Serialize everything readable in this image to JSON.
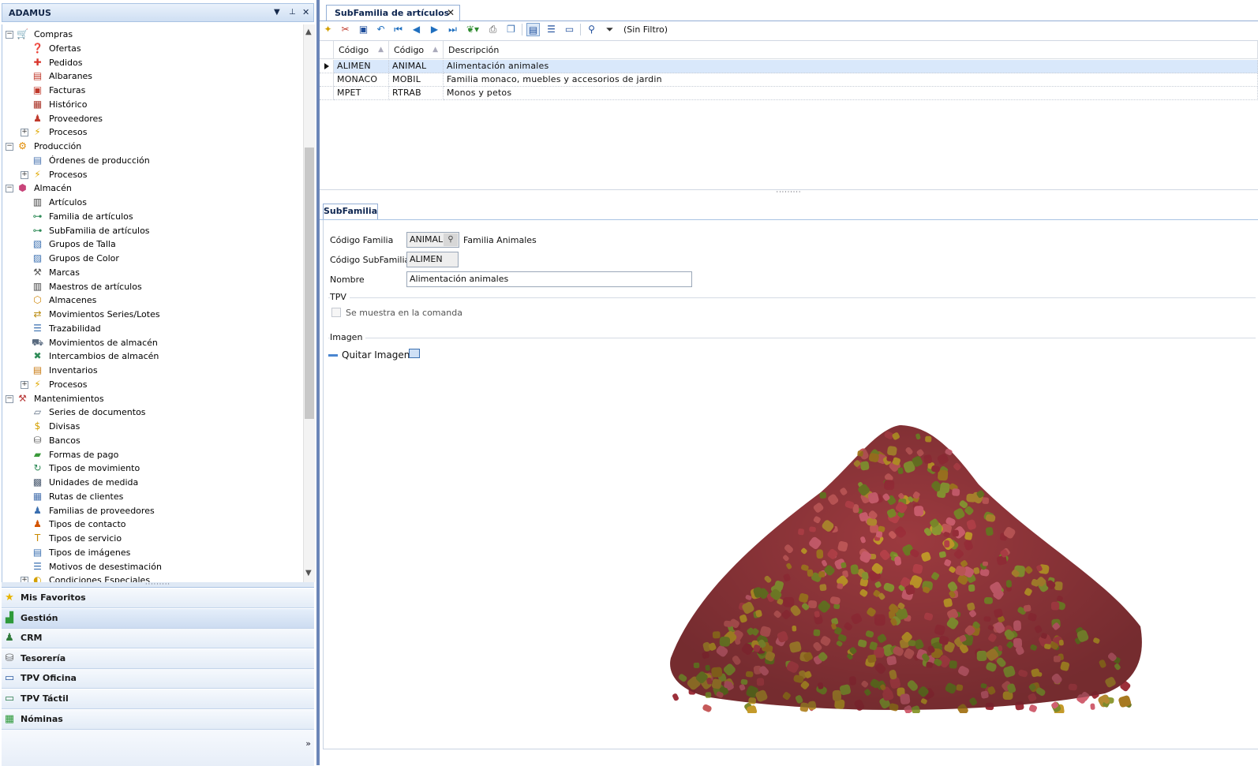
{
  "left_panel": {
    "title": "ADAMUS",
    "tree": [
      {
        "label": "Compras",
        "level": 0,
        "expander": "minus",
        "icon": "shopping-cart-icon",
        "glyph": "🛒",
        "color": "#d83b2b"
      },
      {
        "label": "Ofertas",
        "level": 1,
        "icon": "question-mark-icon",
        "glyph": "❓",
        "color": "#c0392b"
      },
      {
        "label": "Pedidos",
        "level": 1,
        "icon": "red-cross-icon",
        "glyph": "✚",
        "color": "#d9342b"
      },
      {
        "label": "Albaranes",
        "level": 1,
        "icon": "delivery-note-icon",
        "glyph": "▤",
        "color": "#c0392b"
      },
      {
        "label": "Facturas",
        "level": 1,
        "icon": "invoice-icon",
        "glyph": "▣",
        "color": "#c0392b"
      },
      {
        "label": "Histórico",
        "level": 1,
        "icon": "history-icon",
        "glyph": "▦",
        "color": "#a93226"
      },
      {
        "label": "Proveedores",
        "level": 1,
        "icon": "supplier-person-icon",
        "glyph": "♟",
        "color": "#c0392b"
      },
      {
        "label": "Procesos",
        "level": 1,
        "expander": "plus",
        "icon": "lightning-icon",
        "glyph": "⚡",
        "color": "#e0a800"
      },
      {
        "label": "Producción",
        "level": 0,
        "expander": "minus",
        "icon": "gear-icon",
        "glyph": "⚙",
        "color": "#e08a00"
      },
      {
        "label": "Órdenes de producción",
        "level": 1,
        "icon": "production-orders-icon",
        "glyph": "▤",
        "color": "#4a74b0"
      },
      {
        "label": "Procesos",
        "level": 1,
        "expander": "plus",
        "icon": "lightning-icon",
        "glyph": "⚡",
        "color": "#e0a800"
      },
      {
        "label": "Almacén",
        "level": 0,
        "expander": "minus",
        "icon": "warehouse-boxes-icon",
        "glyph": "⬢",
        "color": "#c8447a"
      },
      {
        "label": "Artículos",
        "level": 1,
        "icon": "barcode-icon",
        "glyph": "▥",
        "color": "#444"
      },
      {
        "label": "Familia de artículos",
        "level": 1,
        "icon": "hierarchy-icon",
        "glyph": "⊶",
        "color": "#2e8b57"
      },
      {
        "label": "SubFamilia de artículos",
        "level": 1,
        "icon": "hierarchy-icon",
        "glyph": "⊶",
        "color": "#2e8b57"
      },
      {
        "label": "Grupos de Talla",
        "level": 1,
        "icon": "size-group-icon",
        "glyph": "▧",
        "color": "#3a6fb0"
      },
      {
        "label": "Grupos de Color",
        "level": 1,
        "icon": "color-group-icon",
        "glyph": "▨",
        "color": "#3a6fb0"
      },
      {
        "label": "Marcas",
        "level": 1,
        "icon": "tools-icon",
        "glyph": "⚒",
        "color": "#555"
      },
      {
        "label": "Maestros de artículos",
        "level": 1,
        "icon": "barcode-icon",
        "glyph": "▥",
        "color": "#444"
      },
      {
        "label": "Almacenes",
        "level": 1,
        "icon": "warehouse-icon",
        "glyph": "⬡",
        "color": "#d08a10"
      },
      {
        "label": "Movimientos Series/Lotes",
        "level": 1,
        "icon": "lot-movements-icon",
        "glyph": "⇄",
        "color": "#b98b10"
      },
      {
        "label": "Trazabilidad",
        "level": 1,
        "icon": "traceability-icon",
        "glyph": "☰",
        "color": "#3a6fb0"
      },
      {
        "label": "Movimientos de almacén",
        "level": 1,
        "icon": "truck-icon",
        "glyph": "⛟",
        "color": "#5a6b80"
      },
      {
        "label": "Intercambios de almacén",
        "level": 1,
        "icon": "exchange-icon",
        "glyph": "✖",
        "color": "#2e8b57"
      },
      {
        "label": "Inventarios",
        "level": 1,
        "icon": "inventory-icon",
        "glyph": "▤",
        "color": "#c87a10"
      },
      {
        "label": "Procesos",
        "level": 1,
        "expander": "plus",
        "icon": "lightning-icon",
        "glyph": "⚡",
        "color": "#e0a800"
      },
      {
        "label": "Mantenimientos",
        "level": 0,
        "expander": "minus",
        "icon": "maintenance-tools-icon",
        "glyph": "⚒",
        "color": "#b83a3a"
      },
      {
        "label": "Series de documentos",
        "level": 1,
        "icon": "document-series-icon",
        "glyph": "▱",
        "color": "#5a6b80"
      },
      {
        "label": "Divisas",
        "level": 1,
        "icon": "dollar-icon",
        "glyph": "$",
        "color": "#d4a000"
      },
      {
        "label": "Bancos",
        "level": 1,
        "icon": "bank-icon",
        "glyph": "⛁",
        "color": "#555"
      },
      {
        "label": "Formas de pago",
        "level": 1,
        "icon": "payment-methods-icon",
        "glyph": "▰",
        "color": "#3a9a3a"
      },
      {
        "label": "Tipos de movimiento",
        "level": 1,
        "icon": "movement-types-icon",
        "glyph": "↻",
        "color": "#2e8b57"
      },
      {
        "label": "Unidades de medida",
        "level": 1,
        "icon": "measure-units-icon",
        "glyph": "▩",
        "color": "#4a5a70"
      },
      {
        "label": "Rutas de clientes",
        "level": 1,
        "icon": "customer-routes-icon",
        "glyph": "▦",
        "color": "#4a74b0"
      },
      {
        "label": "Familias de proveedores",
        "level": 1,
        "icon": "supplier-families-icon",
        "glyph": "♟",
        "color": "#3a6fb0"
      },
      {
        "label": "Tipos de contacto",
        "level": 1,
        "icon": "contact-types-icon",
        "glyph": "♟",
        "color": "#d35400"
      },
      {
        "label": "Tipos de servicio",
        "level": 1,
        "icon": "service-types-icon",
        "glyph": "T",
        "color": "#c98a00"
      },
      {
        "label": "Tipos de imágenes",
        "level": 1,
        "icon": "image-types-icon",
        "glyph": "▤",
        "color": "#3a6fb0"
      },
      {
        "label": "Motivos de desestimación",
        "level": 1,
        "icon": "dismissal-reasons-icon",
        "glyph": "☰",
        "color": "#3a6fb0"
      },
      {
        "label": "Condiciones Especiales",
        "level": 1,
        "expander": "plus",
        "icon": "special-conditions-icon",
        "glyph": "◐",
        "color": "#d4a000"
      }
    ],
    "modules": [
      {
        "label": "Mis Favoritos",
        "icon": "star-icon",
        "glyph": "★",
        "color": "#e8b400"
      },
      {
        "label": "Gestión",
        "icon": "bar-chart-icon",
        "glyph": "▟",
        "color": "#2e9a3a",
        "selected": true
      },
      {
        "label": "CRM",
        "icon": "crm-person-icon",
        "glyph": "♟",
        "color": "#2e7a3a"
      },
      {
        "label": "Tesorería",
        "icon": "treasury-icon",
        "glyph": "⛁",
        "color": "#666"
      },
      {
        "label": "TPV Oficina",
        "icon": "monitor-icon",
        "glyph": "▭",
        "color": "#2b5aa0"
      },
      {
        "label": "TPV Táctil",
        "icon": "touch-pos-icon",
        "glyph": "▭",
        "color": "#2b7a4a"
      },
      {
        "label": "Nóminas",
        "icon": "payroll-icon",
        "glyph": "▦",
        "color": "#2e9a3a"
      }
    ],
    "more_label": "»"
  },
  "document": {
    "tab_title": "SubFamilia de artículos",
    "filter_label": "(Sin Filtro)",
    "grid": {
      "columns": [
        "Código",
        "Código",
        "Descripción"
      ],
      "rows": [
        [
          "ALIMEN",
          "ANIMAL",
          "Alimentación animales"
        ],
        [
          "MONACO",
          "MOBIL",
          "Familia monaco, muebles y accesorios de jardin"
        ],
        [
          "MPET",
          "RTRAB",
          "Monos y petos"
        ]
      ],
      "selected_row": 0
    },
    "detail_tab": "SubFamilia",
    "form": {
      "codigo_familia_label": "Código Familia",
      "codigo_familia_value": "ANIMAL",
      "familia_desc": "Familia Animales",
      "codigo_subfamilia_label": "Código SubFamilia",
      "codigo_subfamilia_value": "ALIMEN",
      "nombre_label": "Nombre",
      "nombre_value": "Alimentación animales",
      "tpv_group": "TPV",
      "tpv_checkbox_label": "Se muestra en la comanda",
      "tpv_checked": false,
      "imagen_group": "Imagen",
      "quitar_imagen_label": "Quitar Imagen"
    }
  },
  "colors": {
    "accent": "#6b86b8",
    "selection": "#d9e8fb",
    "header_gradient_top": "#e9f1fb"
  }
}
